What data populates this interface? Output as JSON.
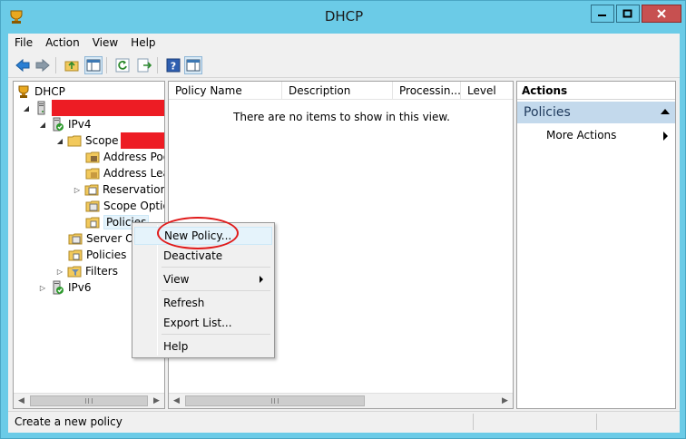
{
  "window": {
    "title": "DHCP",
    "controls": {
      "minimize": "minimize",
      "maximize": "maximize",
      "close": "close"
    }
  },
  "menubar": [
    "File",
    "Action",
    "View",
    "Help"
  ],
  "toolbar": {
    "icons": [
      "back-icon",
      "forward-icon",
      "up-folder-icon",
      "show-hide-console-tree-icon",
      "refresh-icon",
      "export-list-icon",
      "help-icon",
      "show-hide-action-pane-icon"
    ]
  },
  "tree": {
    "root": "DHCP",
    "ipv4": "IPv4",
    "scope": "Scope",
    "address_pool": "Address Poo",
    "address_leases": "Address Lea",
    "reservations": "Reservations",
    "scope_options": "Scope Optio",
    "policies_scope": "Policies",
    "server_options": "Server Op",
    "policies": "Policies",
    "filters": "Filters",
    "ipv6": "IPv6"
  },
  "list": {
    "columns": [
      "Policy Name",
      "Description",
      "Processin...",
      "Level"
    ],
    "empty_message": "There are no items to show in this view."
  },
  "actions": {
    "title": "Actions",
    "section": "Policies",
    "items": [
      "More Actions"
    ]
  },
  "context_menu": {
    "items": [
      "New Policy...",
      "Deactivate",
      "View",
      "Refresh",
      "Export List...",
      "Help"
    ],
    "highlighted": "New Policy..."
  },
  "status": {
    "text": "Create a new policy"
  },
  "colors": {
    "title_bar": "#6bcbe7",
    "close_button": "#c75050",
    "redaction": "#ed1c24",
    "annotation": "#e01b1b",
    "actions_section": "#c3d9ec",
    "highlight": "#e5f3fb"
  }
}
